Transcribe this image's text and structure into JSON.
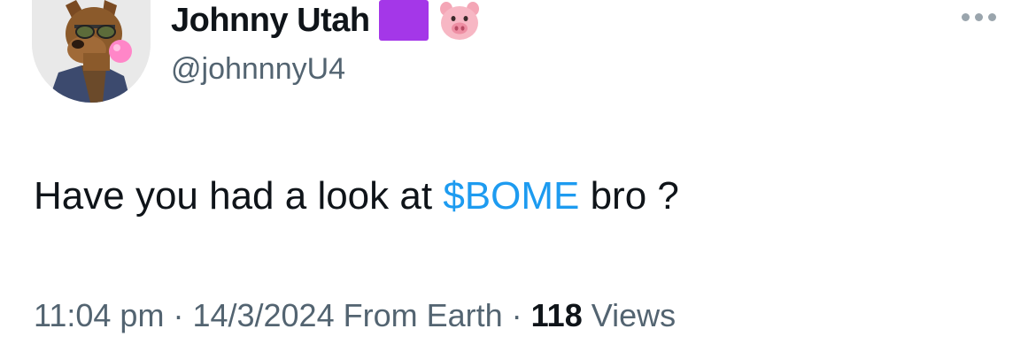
{
  "author": {
    "display_name": "Johnny Utah",
    "handle": "@johnnnyU4",
    "badges": [
      "purple-square",
      "pig-face-emoji"
    ],
    "avatar": "dog-wearing-sunglasses-blowing-bubblegum"
  },
  "tweet": {
    "text_before": "Have you had a look at ",
    "cashtag": "$BOME",
    "text_after": " bro ?"
  },
  "meta": {
    "time": "11:04 pm",
    "sep1": " · ",
    "date": "14/3/2024",
    "source": " From Earth",
    "sep2": " · ",
    "views_count": "118",
    "views_label": " Views"
  },
  "colors": {
    "cashtag": "#1d9bf0",
    "muted": "#536471",
    "text": "#0f1419",
    "purple_badge": "#a437e8"
  },
  "icons": {
    "more": "more-horizontal-icon"
  }
}
